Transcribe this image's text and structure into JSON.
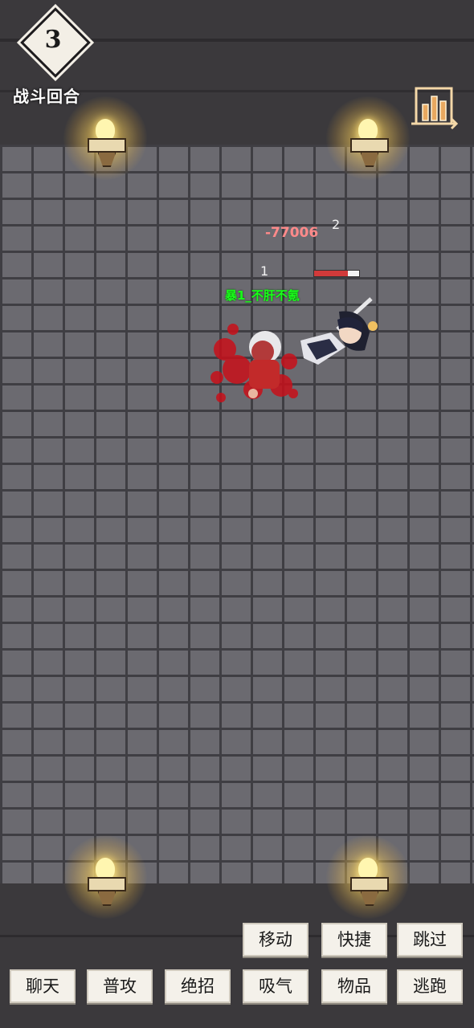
{
  "round": {
    "number": "3",
    "label": "战斗回合"
  },
  "floating": {
    "damage": "-77006",
    "marker_top": "2",
    "marker_left": "1"
  },
  "player": {
    "name": "暴1_不肝不氪",
    "hp_fraction": 0.75
  },
  "actions_row1": [
    "移动",
    "快捷",
    "跳过"
  ],
  "actions_row2": [
    "聊天",
    "普攻",
    "绝招",
    "吸气",
    "物品",
    "逃跑"
  ],
  "icons": {
    "stats": "bar-chart-icon",
    "torch": "torch-icon"
  },
  "colors": {
    "floor": "#6b6a70",
    "wall": "#3b393c",
    "name_text": "#19ff19",
    "damage_text": "#ff8a8a",
    "button_bg": "#f4f1ea"
  }
}
